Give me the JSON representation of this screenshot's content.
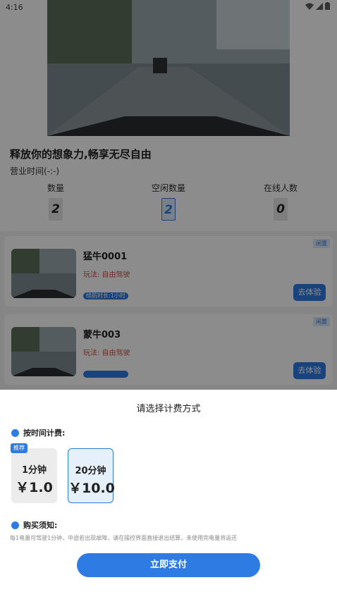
{
  "status_bar": {
    "time": "4:16"
  },
  "headline": "释放你的想象力,畅享无尽自由",
  "hours": "营业时间(-:-)",
  "stats": [
    {
      "label": "数量",
      "value": "2"
    },
    {
      "label": "空闲数量",
      "value": "2"
    },
    {
      "label": "在线人数",
      "value": "0"
    }
  ],
  "cars": [
    {
      "name": "猛牛0001",
      "play": "玩法: 自由驾驶",
      "badge": "续航时长:1小时",
      "status": "闲置",
      "button": "去体验"
    },
    {
      "name": "蒙牛003",
      "play": "玩法: 自由驾驶",
      "badge": "",
      "status": "闲置",
      "button": "去体验"
    }
  ],
  "sheet": {
    "title": "请选择计费方式",
    "time_billing_label": "按时间计费:",
    "options": [
      {
        "label": "1分钟",
        "price": "￥1.0",
        "tag": "推荐"
      },
      {
        "label": "20分钟",
        "price": "￥10.0"
      }
    ],
    "notice_label": "购买须知:",
    "notice_text": "每1电量可驾驶1分钟，中途若出现故障，请在操控界面直接退出结算，未使用完电量将返还",
    "pay_button": "立即支付"
  },
  "colors": {
    "accent": "#2e7be4",
    "play_text": "#d34a3f"
  }
}
